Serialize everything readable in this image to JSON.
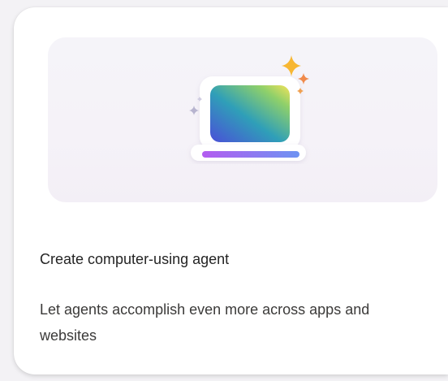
{
  "card": {
    "title": "Create computer-using agent",
    "description": "Let agents accomplish even more across apps and websites",
    "illustration_icon": "laptop-sparkle-icon"
  },
  "colors": {
    "card_background": "#ffffff",
    "hero_background": "#f5f3f8",
    "title_text": "#242424",
    "description_text": "#3b3a39",
    "sparkle_gold": "#f7b733",
    "sparkle_orange": "#f08a4b",
    "screen_gradient": [
      "#3a6fe0",
      "#38b6a0",
      "#e8e25b"
    ],
    "bar_gradient": [
      "#b25cf0",
      "#6b8df5"
    ]
  }
}
